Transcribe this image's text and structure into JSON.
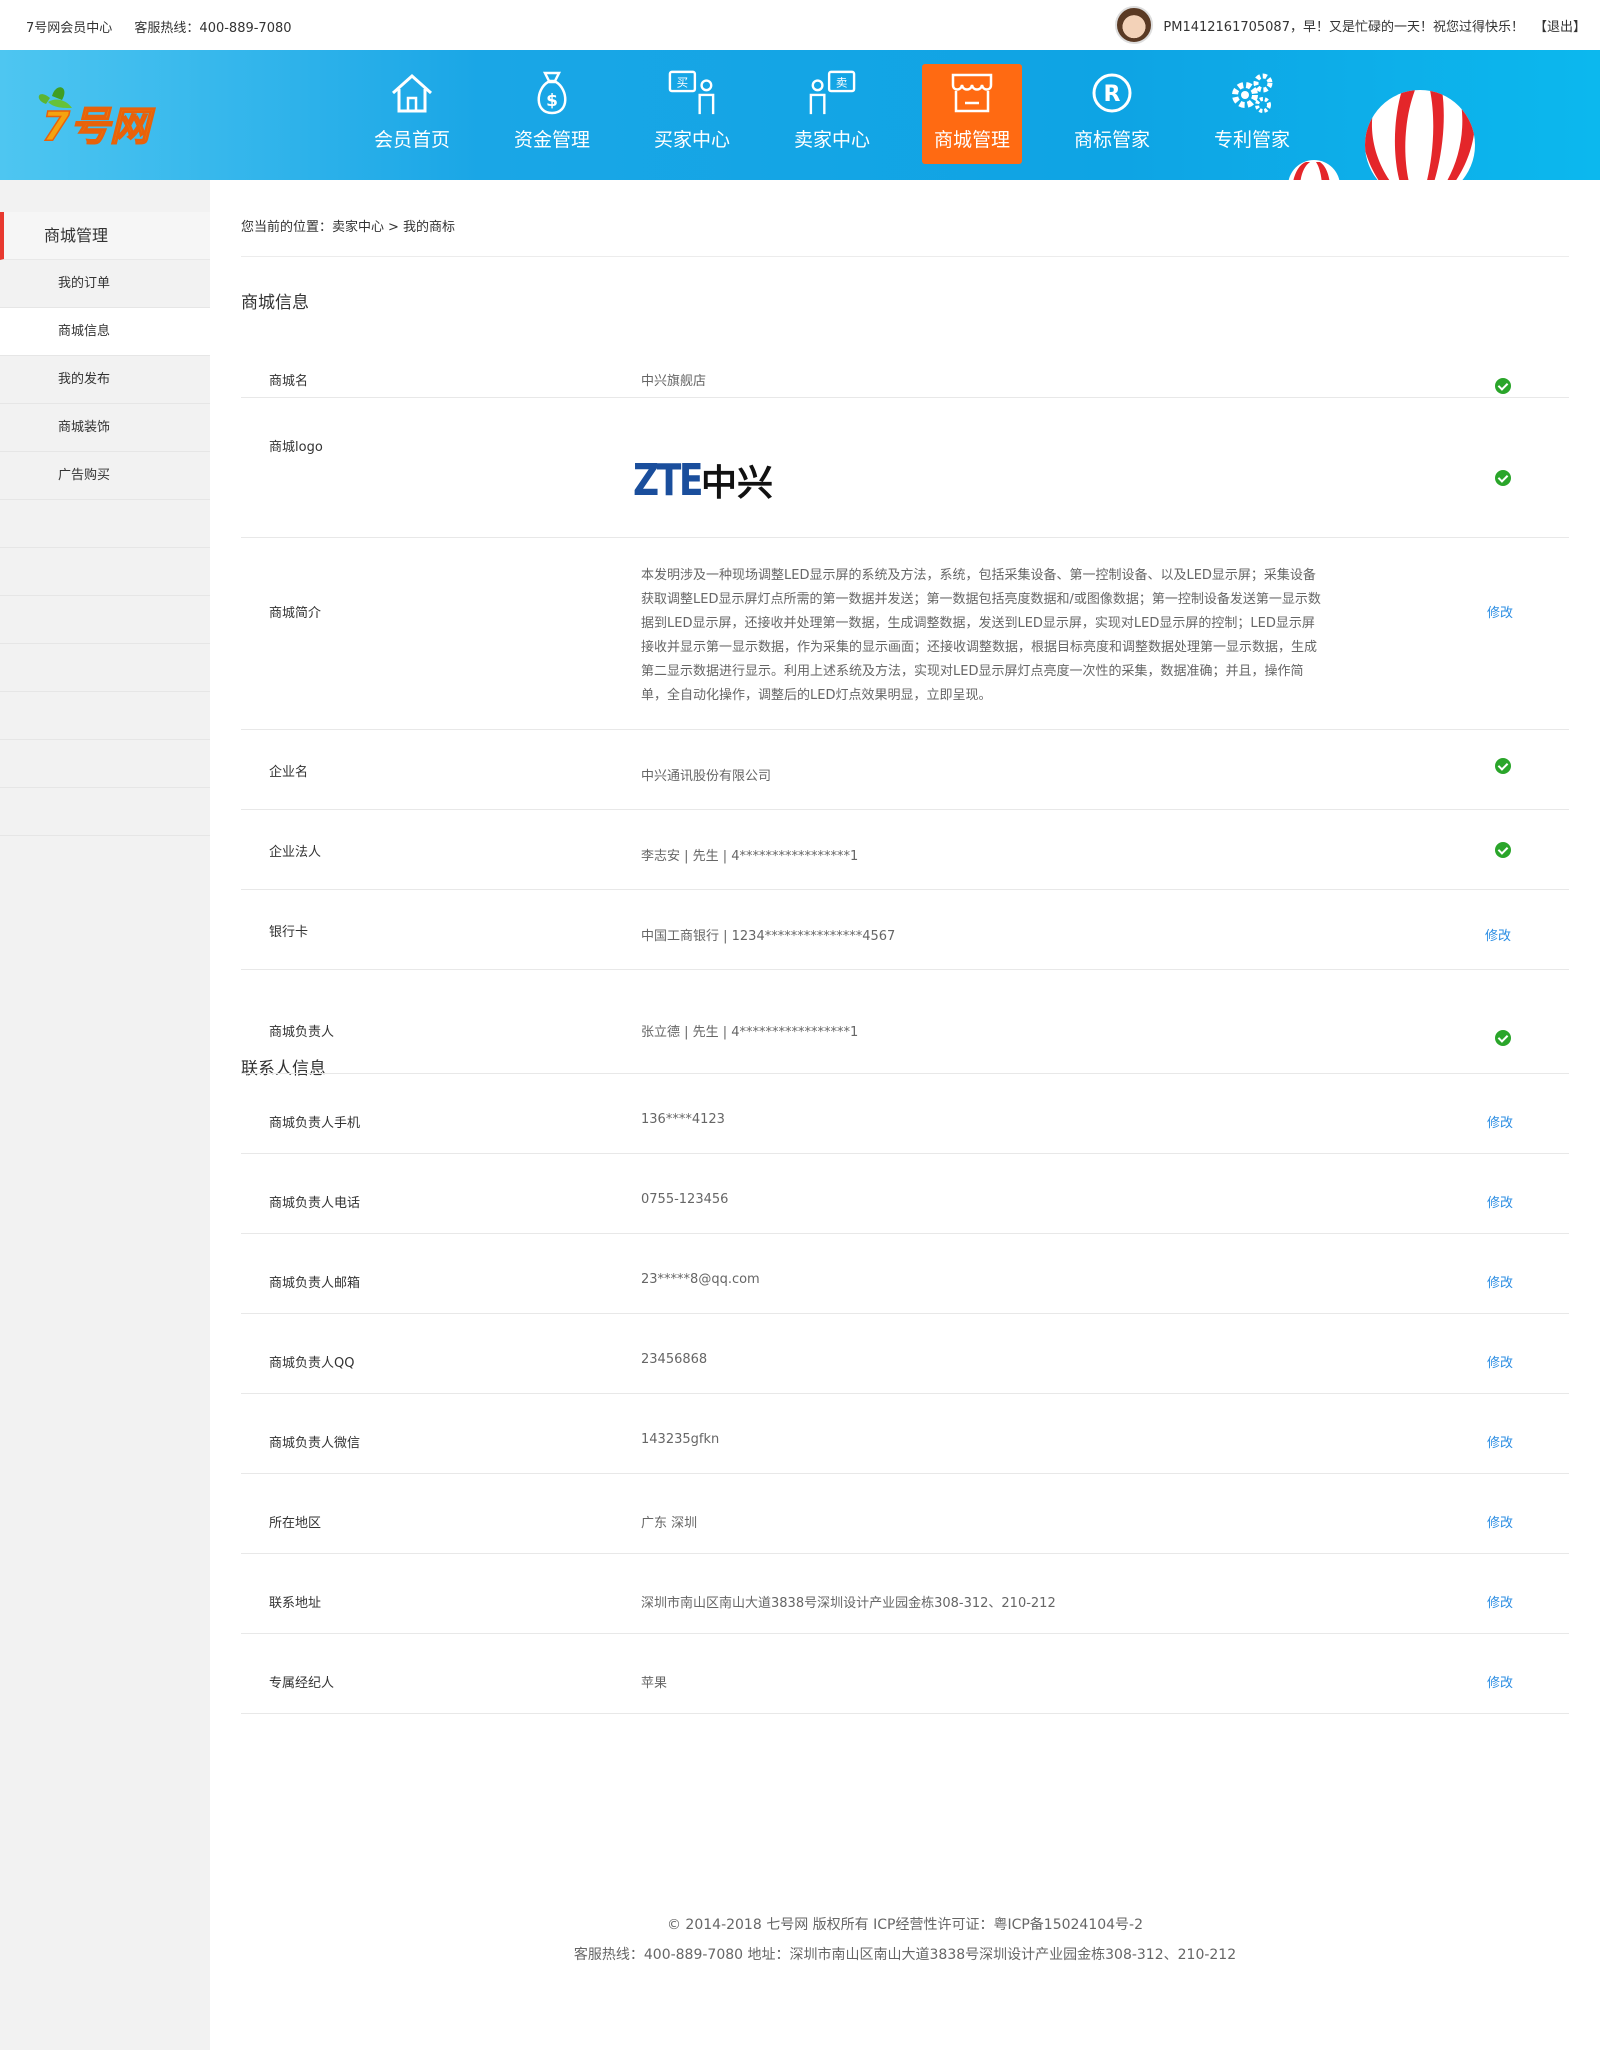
{
  "topbar": {
    "site_name": "7号网会员中心",
    "hotline": "客服热线：400-889-7080",
    "greeting": "PM1412161705087，早！又是忙碌的一天！祝您过得快乐！",
    "logout": "【退出】"
  },
  "nav": {
    "items": [
      {
        "label": "会员首页",
        "icon": "home-icon"
      },
      {
        "label": "资金管理",
        "icon": "money-bag-icon"
      },
      {
        "label": "买家中心",
        "icon": "buyer-icon"
      },
      {
        "label": "卖家中心",
        "icon": "seller-icon"
      },
      {
        "label": "商城管理",
        "icon": "store-icon"
      },
      {
        "label": "商标管家",
        "icon": "registered-icon"
      },
      {
        "label": "专利管家",
        "icon": "gears-icon"
      }
    ],
    "active_index": 4,
    "active_color": "#ff6a12"
  },
  "sidebar": {
    "title": "商城管理",
    "items": [
      "我的订单",
      "商城信息",
      "我的发布",
      "商城装饰",
      "广告购买"
    ],
    "active_index": 1
  },
  "breadcrumb": {
    "prefix": "您当前的位置：",
    "parent": "卖家中心",
    "separator": ">",
    "current": "我的商标"
  },
  "mall_info": {
    "title": "商城信息",
    "name_label": "商城名",
    "name_value": "中兴旗舰店",
    "logo_label": "商城logo",
    "logo_text_latin": "ZTE",
    "logo_text_cn": "中兴",
    "intro_label": "商城简介",
    "intro_value": "本发明涉及一种现场调整LED显示屏的系统及方法，系统，包括采集设备、第一控制设备、以及LED显示屏；采集设备获取调整LED显示屏灯点所需的第一数据并发送；第一数据包括亮度数据和/或图像数据；第一控制设备发送第一显示数据到LED显示屏，还接收并处理第一数据，生成调整数据，发送到LED显示屏，实现对LED显示屏的控制；LED显示屏接收并显示第一显示数据，作为采集的显示画面；还接收调整数据，根据目标亮度和调整数据处理第一显示数据，生成第二显示数据进行显示。利用上述系统及方法，实现对LED显示屏灯点亮度一次性的采集，数据准确；并且，操作简单，全自动化操作，调整后的LED灯点效果明显，立即呈现。",
    "company_label": "企业名",
    "company_value": "中兴通讯股份有限公司",
    "legal_label": "企业法人",
    "legal_value": "李志安 | 先生 | 4*****************1",
    "bank_label": "银行卡",
    "bank_value": "中国工商银行 | 1234***************4567",
    "edit": "修改"
  },
  "contact_info": {
    "title": "联系人信息",
    "rows": [
      {
        "label": "商城负责人",
        "value": "张立德 | 先生 | 4*****************1",
        "status": "verified"
      },
      {
        "label": "商城负责人手机",
        "value": "136****4123",
        "status": "edit"
      },
      {
        "label": "商城负责人电话",
        "value": "0755-123456",
        "status": "edit"
      },
      {
        "label": "商城负责人邮箱",
        "value": "23*****8@qq.com",
        "status": "edit"
      },
      {
        "label": "商城负责人QQ",
        "value": "23456868",
        "status": "edit"
      },
      {
        "label": "商城负责人微信",
        "value": "143235gfkn",
        "status": "edit"
      },
      {
        "label": "所在地区",
        "value": "广东 深圳",
        "status": "edit"
      },
      {
        "label": "联系地址",
        "value": "深圳市南山区南山大道3838号深圳设计产业园金栋308-312、210-212",
        "status": "edit"
      },
      {
        "label": "专属经纪人",
        "value": "苹果",
        "status": "edit"
      }
    ],
    "edit": "修改"
  },
  "footer": {
    "line1": "© 2014-2018 七号网 版权所有 ICP经营性许可证：粤ICP备15024104号-2",
    "line2": "客服热线：400-889-7080  地址：深圳市南山区南山大道3838号深圳设计产业园金栋308-312、210-212"
  },
  "colors": {
    "header_blue": "#0ea4e4",
    "edit_link": "#2a8de3",
    "verified_green": "#2aa52a",
    "sidebar_accent": "#e8392f"
  }
}
